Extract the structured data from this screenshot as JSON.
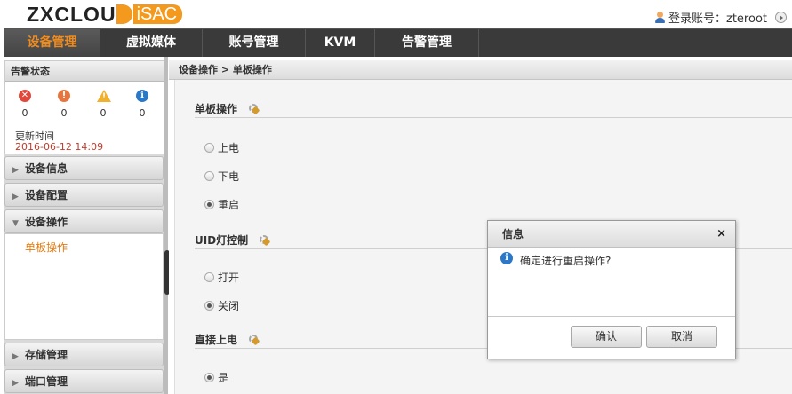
{
  "header": {
    "logo_main": "ZXCLOU",
    "logo_sub": "iSAC",
    "user_label": "登录账号：zteroot"
  },
  "nav": {
    "items": [
      {
        "label": "设备管理",
        "active": true
      },
      {
        "label": "虚拟媒体",
        "active": false
      },
      {
        "label": "账号管理",
        "active": false
      },
      {
        "label": "KVM",
        "active": false
      },
      {
        "label": "告警管理",
        "active": false
      }
    ]
  },
  "alarm": {
    "title": "告警状态",
    "counts": {
      "critical": "0",
      "major": "0",
      "minor": "0",
      "info": "0"
    },
    "update_label": "更新时间",
    "update_time": "2016-06-12 14:09"
  },
  "sidebar": {
    "items": [
      {
        "label": "设备信息",
        "expanded": false
      },
      {
        "label": "设备配置",
        "expanded": false
      },
      {
        "label": "设备操作",
        "expanded": true
      },
      {
        "label": "存储管理",
        "expanded": false
      },
      {
        "label": "端口管理",
        "expanded": false
      }
    ],
    "sub_item": "单板操作"
  },
  "breadcrumb": "设备操作 > 单板操作",
  "sections": {
    "board": {
      "title": "单板操作",
      "options": [
        {
          "label": "上电",
          "checked": false
        },
        {
          "label": "下电",
          "checked": false
        },
        {
          "label": "重启",
          "checked": true
        }
      ]
    },
    "uid": {
      "title": "UID灯控制",
      "options": [
        {
          "label": "打开",
          "checked": false
        },
        {
          "label": "关闭",
          "checked": true
        }
      ]
    },
    "direct": {
      "title": "直接上电",
      "options": [
        {
          "label": "是",
          "checked": true
        }
      ]
    }
  },
  "dialog": {
    "title": "信息",
    "close": "×",
    "message": "确定进行重启操作?",
    "confirm": "确认",
    "cancel": "取消"
  },
  "colors": {
    "accent": "#f08b1e",
    "nav_bg": "#3a3a3a",
    "time_red": "#c03a2b"
  }
}
